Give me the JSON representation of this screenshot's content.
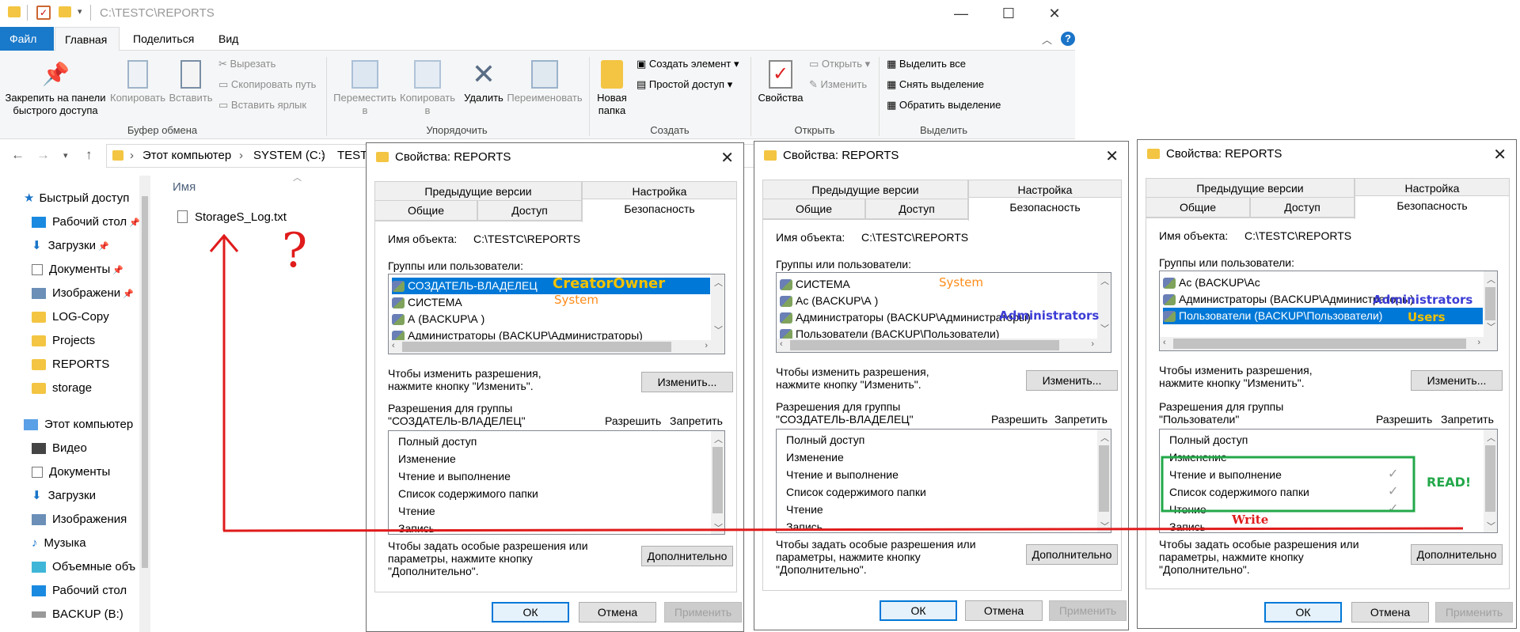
{
  "explorer": {
    "title_path": "C:\\TESTC\\REPORTS",
    "menu_tabs": [
      "Файл",
      "Главная",
      "Поделиться",
      "Вид"
    ],
    "clipboard": {
      "pin": "Закрепить на панели быстрого доступа",
      "pin_l1": "Закрепить на панели",
      "pin_l2": "быстрого доступа",
      "copy": "Копировать",
      "paste": "Вставить",
      "cut": "Вырезать",
      "copy_path": "Скопировать путь",
      "paste_shortcut": "Вставить ярлык",
      "group": "Буфер обмена"
    },
    "organize": {
      "move_to": "Переместить в",
      "move_l1": "Переместить",
      "move_l2": "в",
      "copy_to": "Копировать в",
      "copy_l1": "Копировать",
      "copy_l2": "в",
      "delete": "Удалить",
      "rename": "Переименовать",
      "group": "Упорядочить"
    },
    "create": {
      "new_folder_l1": "Новая",
      "new_folder_l2": "папка",
      "new_item": "Создать элемент",
      "easy_access": "Простой доступ",
      "group": "Создать"
    },
    "open": {
      "properties": "Свойства",
      "open": "Открыть",
      "edit": "Изменить",
      "group": "Открыть"
    },
    "select": {
      "select_all": "Выделить все",
      "select_none": "Снять выделение",
      "invert": "Обратить выделение",
      "group": "Выделить"
    },
    "breadcrumb": [
      "Этот компьютер",
      "SYSTEM (C:)",
      "TESTC"
    ],
    "column_name": "Имя",
    "files": [
      "StorageS_Log.txt"
    ],
    "nav": {
      "quick_access": "Быстрый доступ",
      "quick_items": [
        "Рабочий стол",
        "Загрузки",
        "Документы",
        "Изображени",
        "LOG-Copy",
        "Projects",
        "REPORTS",
        "storage"
      ],
      "this_pc": "Этот компьютер",
      "pc_items": [
        "Видео",
        "Документы",
        "Загрузки",
        "Изображения",
        "Музыка",
        "Объемные объ",
        "Рабочий стол",
        "BACKUP (B:)"
      ]
    }
  },
  "dialog_common": {
    "title": "Свойства: REPORTS",
    "tabs_top": [
      "Предыдущие версии",
      "Настройка"
    ],
    "tabs_bottom": [
      "Общие",
      "Доступ",
      "Безопасность"
    ],
    "object_label": "Имя объекта:",
    "object_value": "C:\\TESTC\\REPORTS",
    "groups_label": "Группы или пользователи:",
    "change_hint_l1": "Чтобы изменить разрешения,",
    "change_hint_l2": "нажмите кнопку \"Изменить\".",
    "change_btn": "Изменить...",
    "allow": "Разрешить",
    "deny": "Запретить",
    "perms": [
      "Полный доступ",
      "Изменение",
      "Чтение и выполнение",
      "Список содержимого папки",
      "Чтение",
      "Запись"
    ],
    "special_l1": "Чтобы задать особые разрешения или",
    "special_l2": "параметры, нажмите кнопку",
    "special_l3": "\"Дополнительно\".",
    "advanced_btn": "Дополнительно",
    "ok": "ОК",
    "cancel": "Отмена",
    "apply": "Применить"
  },
  "dialog1": {
    "users": [
      "СОЗДАТЕЛЬ-ВЛАДЕЛЕЦ",
      "СИСТЕМА",
      "А           (BACKUP\\А        )",
      "Администраторы (BACKUP\\Администраторы)"
    ],
    "perm_for_l1": "Разрешения для группы",
    "perm_for_l2": "\"СОЗДАТЕЛЬ-ВЛАДЕЛЕЦ\""
  },
  "dialog2": {
    "users": [
      "СИСТЕМА",
      "Ас          (BACKUP\\А        )",
      "Администраторы (BACKUP\\Администраторы)",
      "Пользователи (BACKUP\\Пользователи)"
    ],
    "perm_for_l1": "Разрешения для группы",
    "perm_for_l2": "\"СОЗДАТЕЛЬ-ВЛАДЕЛЕЦ\""
  },
  "dialog3": {
    "users": [
      "Ас          (BACKUP\\Ас",
      "Администраторы (BACKUP\\Администраторы)",
      "Пользователи (BACKUP\\Пользователи)"
    ],
    "perm_for_l1": "Разрешения для группы",
    "perm_for_l2": "\"Пользователи\""
  },
  "annotations": {
    "creator_owner": "CreatorOwner",
    "system1": "System",
    "system2": "System",
    "administrators2": "Administrators",
    "administrators3": "Administrators",
    "users3": "Users",
    "read": "READ!",
    "write": "Write",
    "question": "?",
    "colors": {
      "red": "#e01b1b",
      "orange": "#ff8c1a",
      "blue": "#3d3dd6",
      "green": "#23a84a",
      "yellow": "#f2c200"
    }
  }
}
